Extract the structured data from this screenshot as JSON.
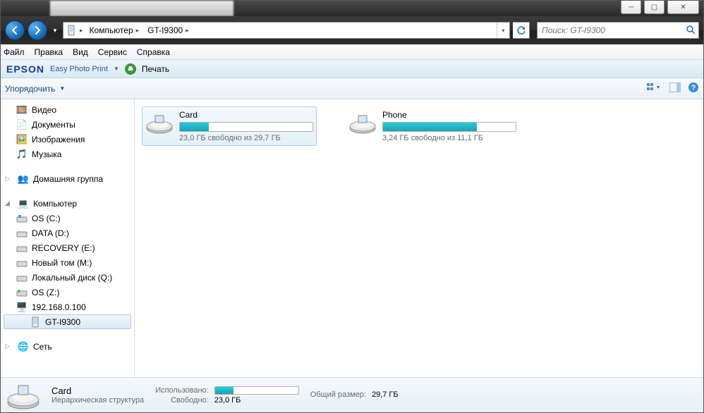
{
  "title_controls": {
    "min": "─",
    "max": "▢",
    "close": "✕"
  },
  "address": {
    "seg1": "Компьютер",
    "seg2": "GT-I9300"
  },
  "search": {
    "placeholder": "Поиск: GT-I9300"
  },
  "menu": {
    "file": "Файл",
    "edit": "Правка",
    "view": "Вид",
    "service": "Сервис",
    "help": "Справка"
  },
  "epson": {
    "logo": "EPSON",
    "sub": "Easy Photo Print",
    "print": "Печать"
  },
  "toolbar": {
    "organize": "Упорядочить"
  },
  "sidebar": {
    "video": "Видео",
    "documents": "Документы",
    "images": "Изображения",
    "music": "Музыка",
    "homegroup": "Домашняя группа",
    "computer": "Компьютер",
    "os_c": "OS (C:)",
    "data_d": "DATA (D:)",
    "recovery_e": "RECOVERY (E:)",
    "newvol_m": "Новый том (M:)",
    "local_q": "Локальный диск (Q:)",
    "os_z": "OS (Z:)",
    "ip": "192.168.0.100",
    "gti": "GT-I9300",
    "network": "Сеть"
  },
  "drives": {
    "card": {
      "name": "Card",
      "sub": "23,0 ГБ свободно из 29,7 ГБ",
      "pct": 22
    },
    "phone": {
      "name": "Phone",
      "sub": "3,24 ГБ свободно из 11,1 ГБ",
      "pct": 71
    }
  },
  "details": {
    "name": "Card",
    "type": "Иерархическая структура",
    "used_lbl": "Использовано:",
    "free_lbl": "Свободно:",
    "free_val": "23,0 ГБ",
    "total_lbl": "Общий размер:",
    "total_val": "29,7 ГБ",
    "used_pct": 22
  }
}
